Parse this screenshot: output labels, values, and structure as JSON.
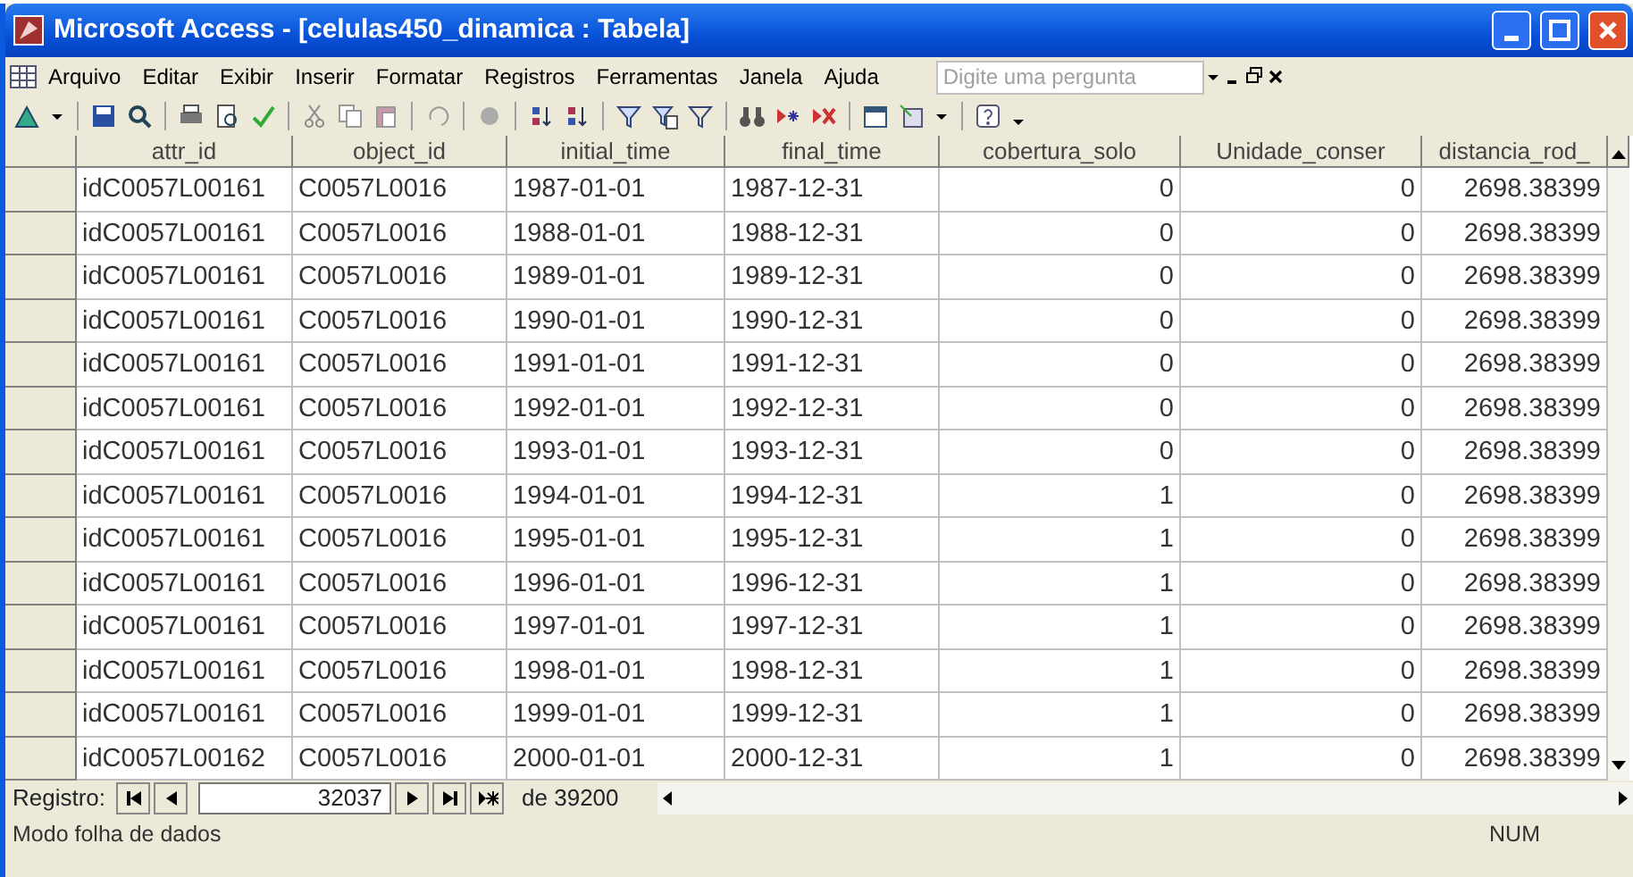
{
  "window": {
    "title": "Microsoft Access - [celulas450_dinamica : Tabela]"
  },
  "menu": [
    "Arquivo",
    "Editar",
    "Exibir",
    "Inserir",
    "Formatar",
    "Registros",
    "Ferramentas",
    "Janela",
    "Ajuda"
  ],
  "help_search": {
    "placeholder": "Digite uma pergunta"
  },
  "table": {
    "columns": [
      "attr_id",
      "object_id",
      "initial_time",
      "final_time",
      "cobertura_solo",
      "Unidade_conser",
      "distancia_rod_"
    ],
    "rows": [
      [
        "idC0057L00161",
        "C0057L0016",
        "1987-01-01",
        "1987-12-31",
        "0",
        "0",
        "2698.38399"
      ],
      [
        "idC0057L00161",
        "C0057L0016",
        "1988-01-01",
        "1988-12-31",
        "0",
        "0",
        "2698.38399"
      ],
      [
        "idC0057L00161",
        "C0057L0016",
        "1989-01-01",
        "1989-12-31",
        "0",
        "0",
        "2698.38399"
      ],
      [
        "idC0057L00161",
        "C0057L0016",
        "1990-01-01",
        "1990-12-31",
        "0",
        "0",
        "2698.38399"
      ],
      [
        "idC0057L00161",
        "C0057L0016",
        "1991-01-01",
        "1991-12-31",
        "0",
        "0",
        "2698.38399"
      ],
      [
        "idC0057L00161",
        "C0057L0016",
        "1992-01-01",
        "1992-12-31",
        "0",
        "0",
        "2698.38399"
      ],
      [
        "idC0057L00161",
        "C0057L0016",
        "1993-01-01",
        "1993-12-31",
        "0",
        "0",
        "2698.38399"
      ],
      [
        "idC0057L00161",
        "C0057L0016",
        "1994-01-01",
        "1994-12-31",
        "1",
        "0",
        "2698.38399"
      ],
      [
        "idC0057L00161",
        "C0057L0016",
        "1995-01-01",
        "1995-12-31",
        "1",
        "0",
        "2698.38399"
      ],
      [
        "idC0057L00161",
        "C0057L0016",
        "1996-01-01",
        "1996-12-31",
        "1",
        "0",
        "2698.38399"
      ],
      [
        "idC0057L00161",
        "C0057L0016",
        "1997-01-01",
        "1997-12-31",
        "1",
        "0",
        "2698.38399"
      ],
      [
        "idC0057L00161",
        "C0057L0016",
        "1998-01-01",
        "1998-12-31",
        "1",
        "0",
        "2698.38399"
      ],
      [
        "idC0057L00161",
        "C0057L0016",
        "1999-01-01",
        "1999-12-31",
        "1",
        "0",
        "2698.38399"
      ],
      [
        "idC0057L00162",
        "C0057L0016",
        "2000-01-01",
        "2000-12-31",
        "1",
        "0",
        "2698.38399"
      ]
    ]
  },
  "navigator": {
    "label": "Registro:",
    "record": "32037",
    "total": "de 39200"
  },
  "status_bar": {
    "mode": "Modo folha de dados",
    "num": "NUM"
  }
}
